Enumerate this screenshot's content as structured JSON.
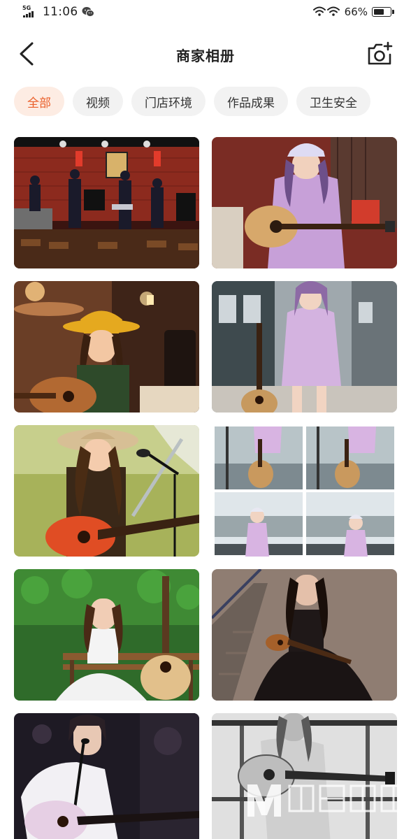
{
  "status_bar": {
    "network": "5G",
    "time": "11:06",
    "battery_percent": "66%",
    "battery_level": 0.66
  },
  "nav": {
    "title": "商家相册"
  },
  "filters": [
    {
      "label": "全部",
      "active": true
    },
    {
      "label": "视频",
      "active": false
    },
    {
      "label": "门店环境",
      "active": false
    },
    {
      "label": "作品成果",
      "active": false
    },
    {
      "label": "卫生安全",
      "active": false
    }
  ],
  "colors": {
    "accent": "#ea5f2a",
    "chip_active_bg": "#fdece3",
    "chip_bg": "#f2f2f2"
  }
}
